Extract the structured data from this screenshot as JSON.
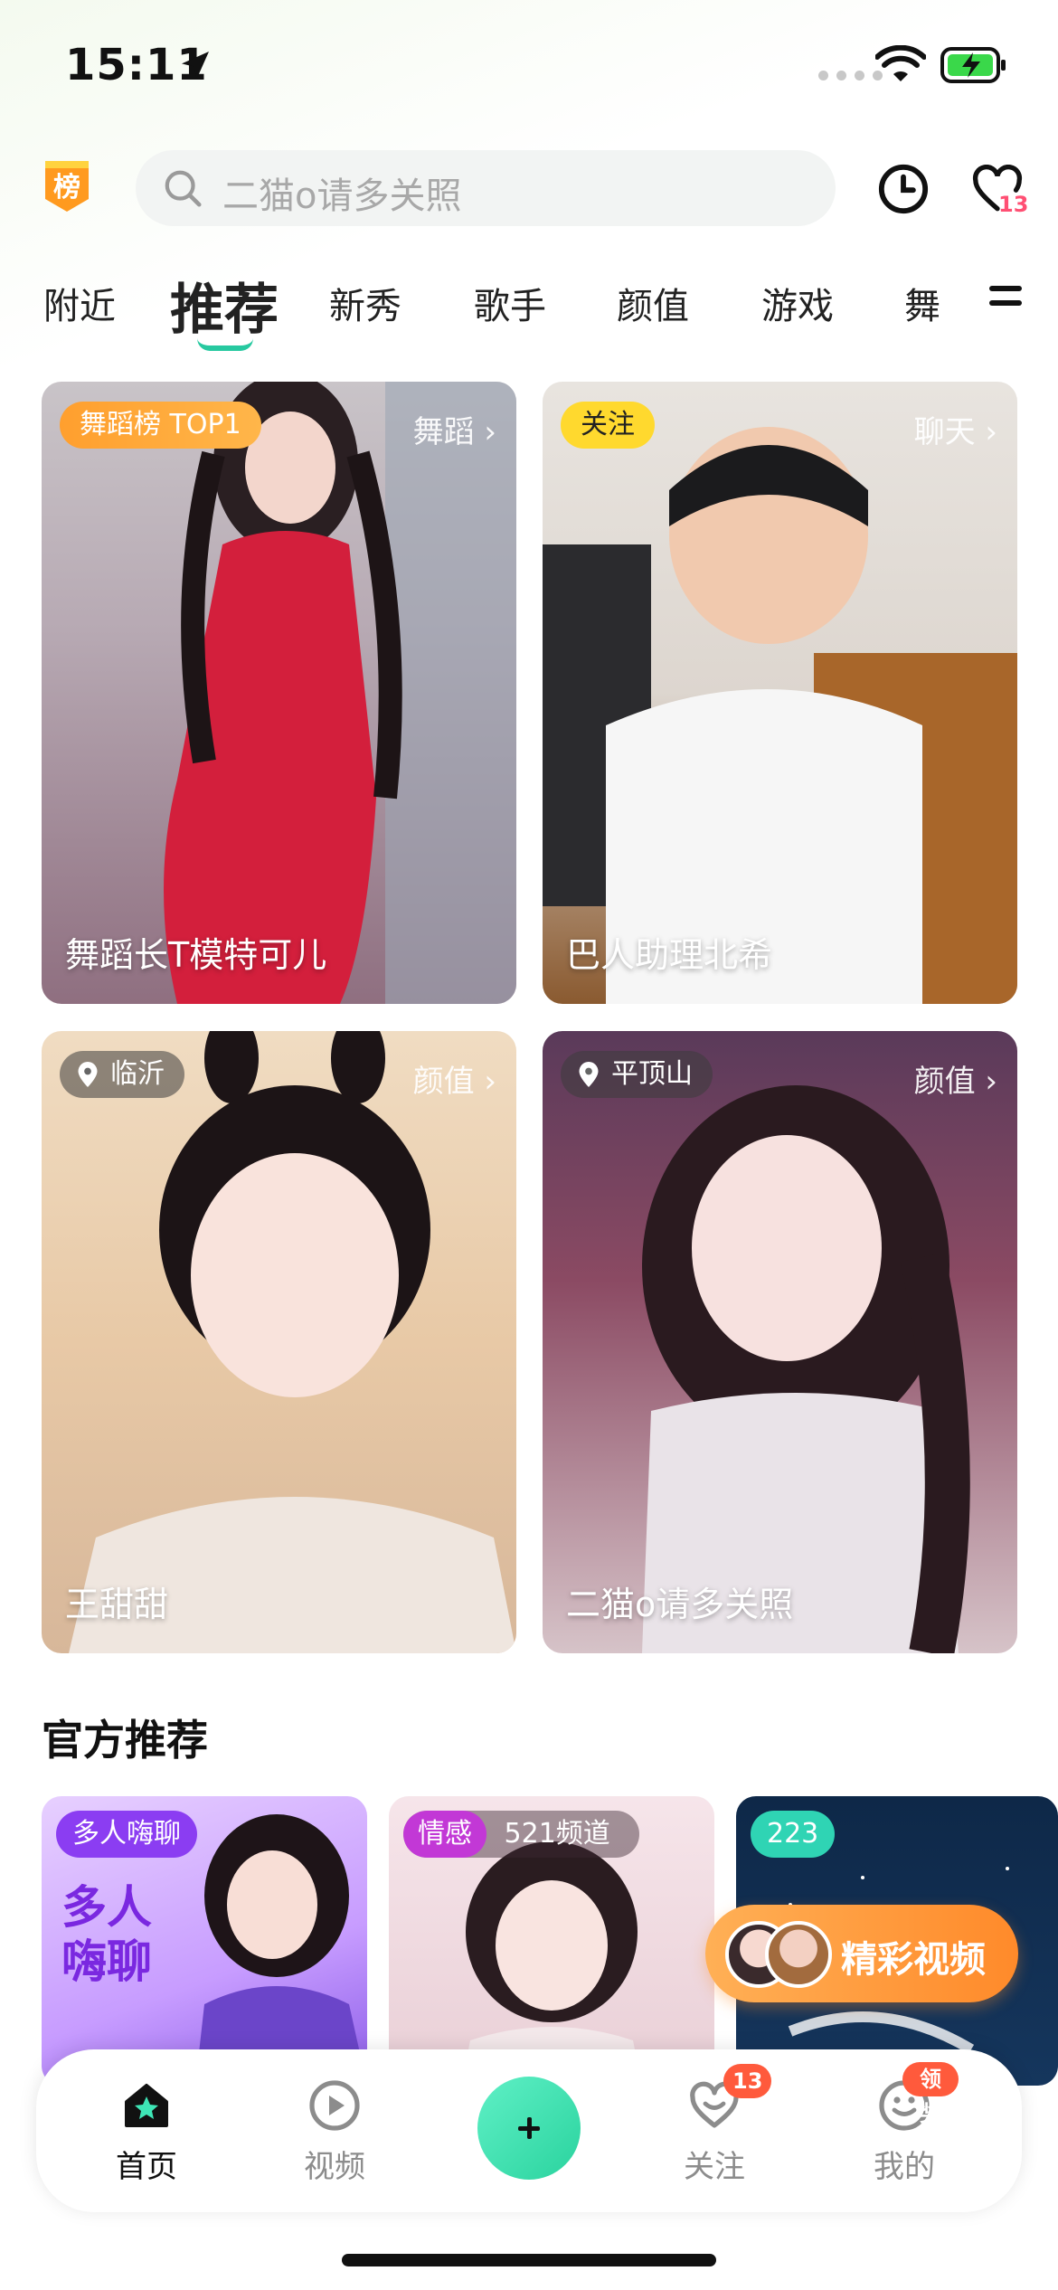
{
  "status_bar": {
    "time": "15:11"
  },
  "header": {
    "rank_badge": "榜",
    "search_placeholder": "二猫o请多关照",
    "favorites_count": "13"
  },
  "tabs": [
    {
      "label": "附近"
    },
    {
      "label": "推荐"
    },
    {
      "label": "新秀"
    },
    {
      "label": "歌手"
    },
    {
      "label": "颜值"
    },
    {
      "label": "游戏"
    },
    {
      "label": "舞"
    }
  ],
  "cards": [
    {
      "tag": "舞蹈榜 TOP1",
      "category": "舞蹈 ›",
      "name": "舞蹈长T模特可儿"
    },
    {
      "tag": "关注",
      "category": "聊天 ›",
      "name": "巴人助理北希"
    },
    {
      "tag": "临沂",
      "category": "颜值 ›",
      "name": "王甜甜"
    },
    {
      "tag": "平顶山",
      "category": "颜值 ›",
      "name": "二猫o请多关照"
    }
  ],
  "section": {
    "title": "官方推荐"
  },
  "recommendations": [
    {
      "tag": "多人嗨聊",
      "art_text": "多人\n嗨聊"
    },
    {
      "tag": "情感",
      "extra": "521频道"
    },
    {
      "tag": "223"
    }
  ],
  "float_button": {
    "label": "精彩视频"
  },
  "tabbar": {
    "items": [
      {
        "label": "首页"
      },
      {
        "label": "视频"
      },
      {
        "label": "关注"
      },
      {
        "label": "我的"
      }
    ],
    "follow_badge": "13",
    "mine_badge": "领奖"
  },
  "colors": {
    "accent": "#2ad39e",
    "orange": "#ff8a2a",
    "badge_red": "#ff5a3c"
  }
}
